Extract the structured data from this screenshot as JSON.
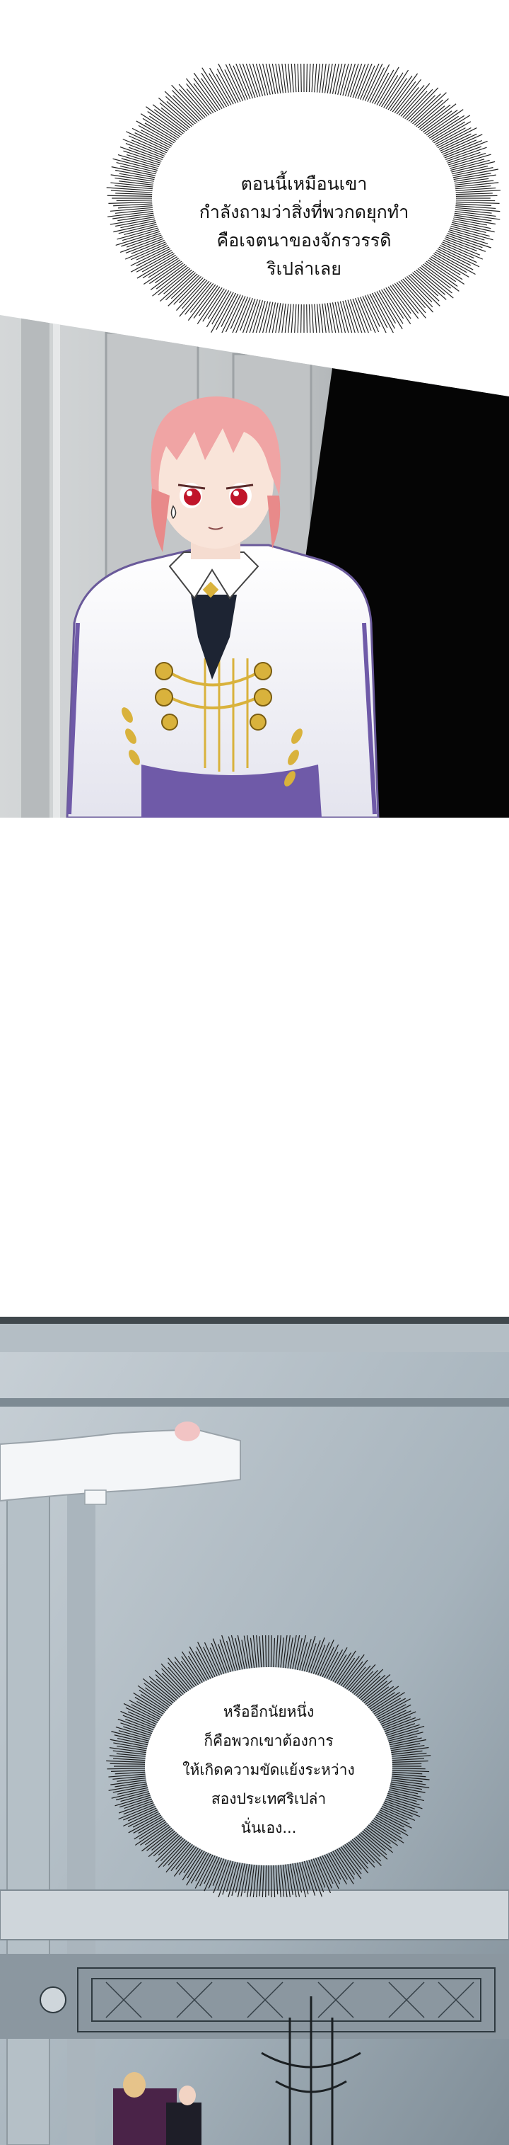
{
  "bubble_top": {
    "lines": [
      "ตอนนี้เหมือนเขา",
      "กำลังถามว่าสิ่งที่พวกดยุกทำ",
      "คือเจตนาของจักรวรรดิ",
      "ริเปล่าเลย"
    ]
  },
  "bubble_bottom": {
    "lines": [
      "หรืออีกนัยหนึ่ง",
      "ก็คือพวกเขาต้องการ",
      "ให้เกิดความขัดแย้งระหว่าง",
      "สองประเทศริเปล่า",
      "นั่นเอง..."
    ]
  },
  "colors": {
    "panel_bg_gray": "#c9cccd",
    "shadow_black": "#050505",
    "hair_pink": "#f0a4a4",
    "eye_red": "#c0152a",
    "coat_white": "#f6f6f8",
    "gold": "#d9b23c",
    "sash_purple": "#6f5aa8",
    "scene2_blue_gray": "#9aa8b2"
  }
}
